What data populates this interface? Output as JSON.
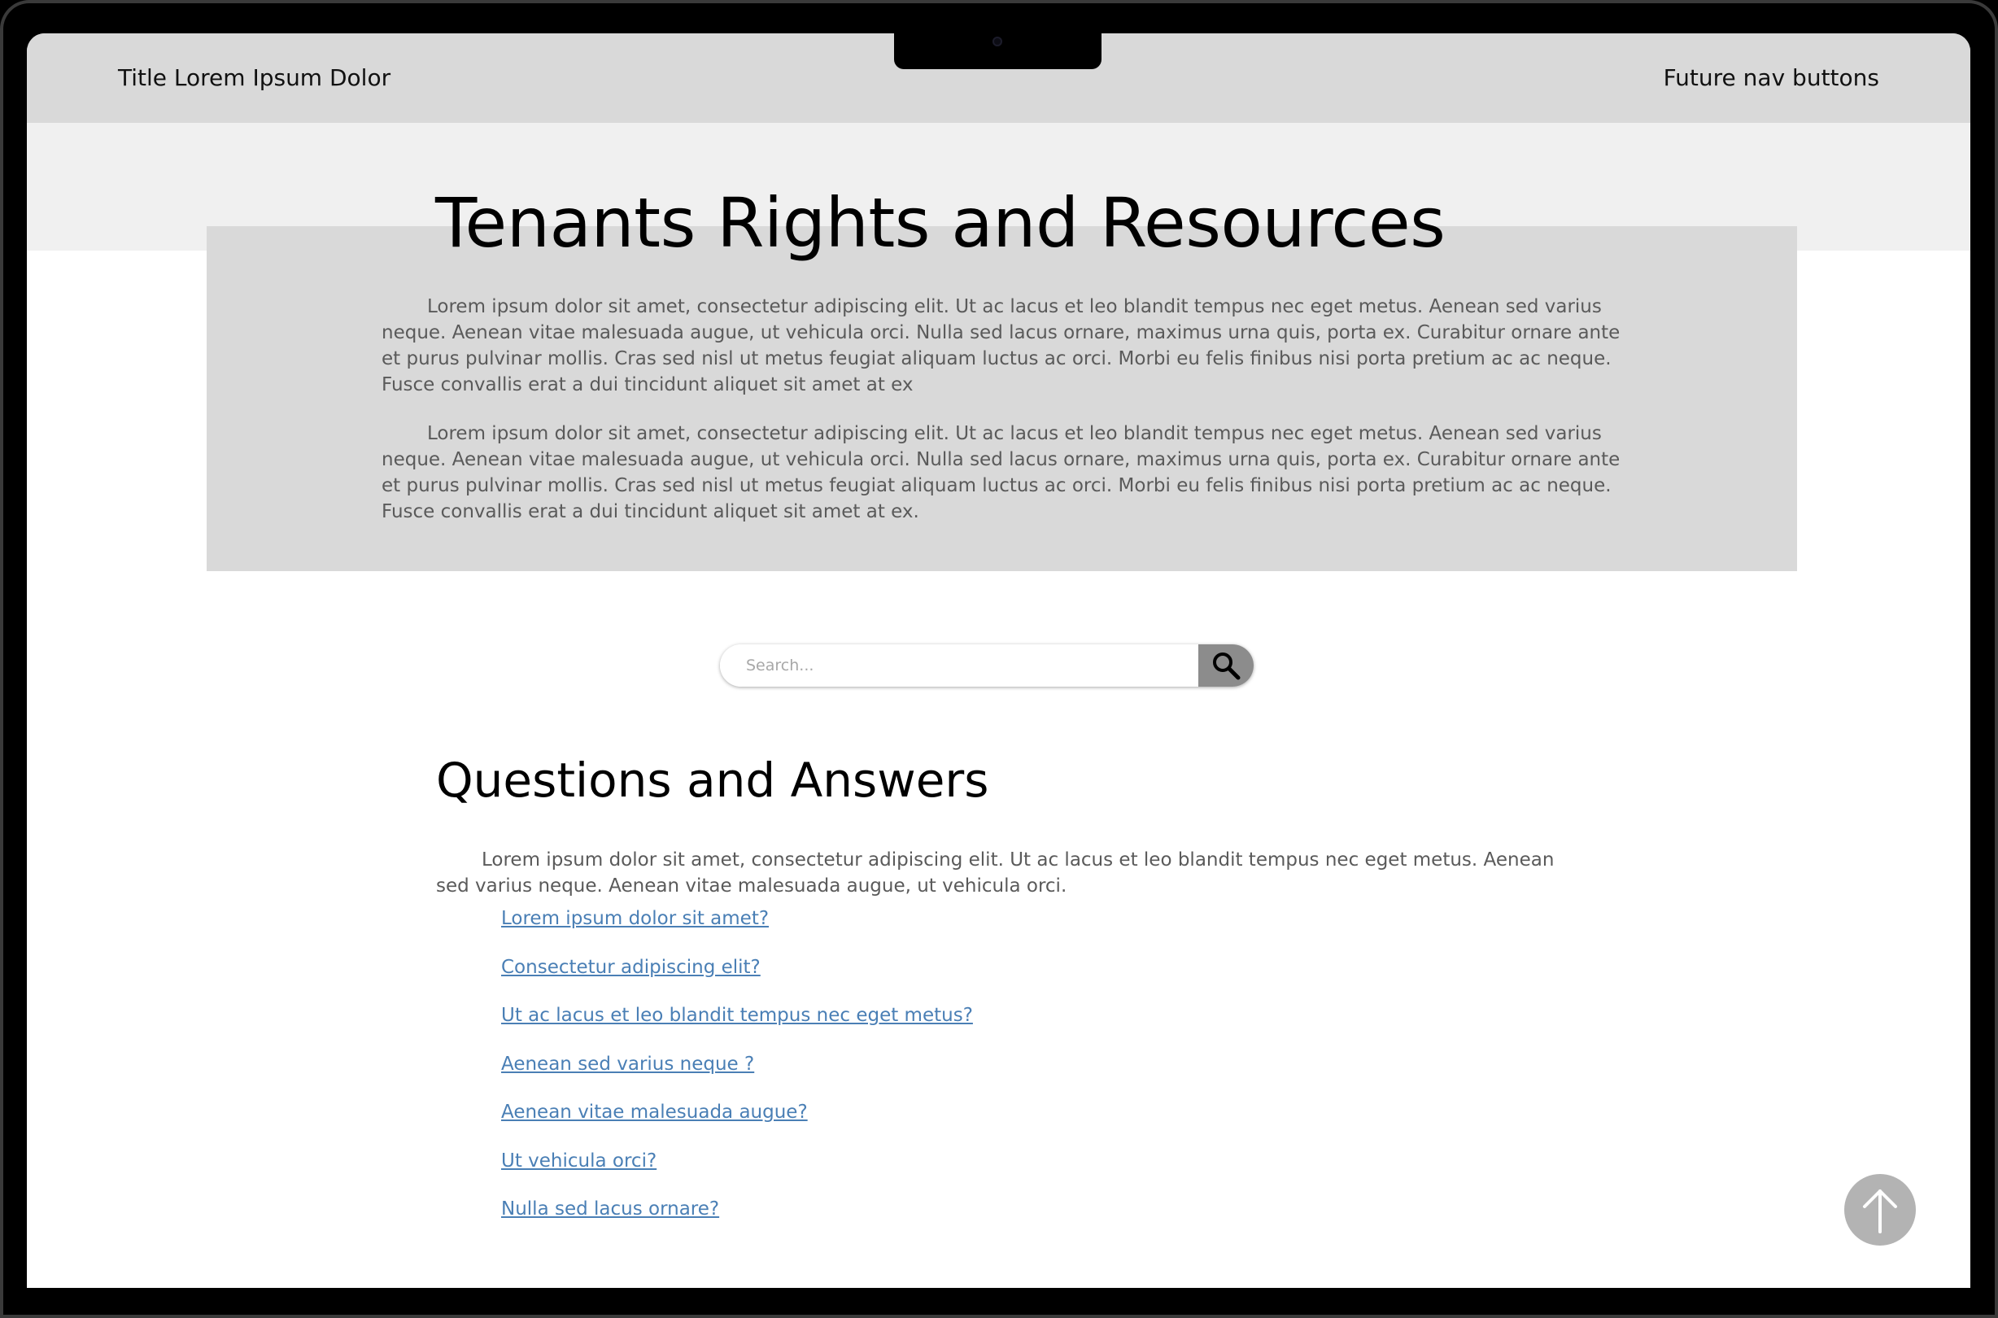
{
  "header": {
    "title": "Title Lorem Ipsum Dolor",
    "nav_text": "Future nav buttons"
  },
  "hero": {
    "title": "Tenants Rights and Resources",
    "paragraphs": [
      "Lorem ipsum dolor sit amet, consectetur adipiscing elit. Ut ac lacus et leo blandit tempus nec eget metus. Aenean sed varius neque. Aenean vitae malesuada augue, ut vehicula orci. Nulla sed lacus ornare, maximus urna quis, porta ex. Curabitur ornare ante et purus pulvinar mollis. Cras sed nisl ut metus feugiat aliquam luctus ac orci. Morbi eu felis finibus nisi porta pretium ac ac neque. Fusce convallis erat a dui tincidunt aliquet sit amet at ex",
      "Lorem ipsum dolor sit amet, consectetur adipiscing elit. Ut ac lacus et leo blandit tempus nec eget metus. Aenean sed varius neque. Aenean vitae malesuada augue, ut vehicula orci. Nulla sed lacus ornare, maximus urna quis, porta ex. Curabitur ornare ante et purus pulvinar mollis. Cras sed nisl ut metus feugiat aliquam luctus ac orci. Morbi eu felis finibus nisi porta pretium ac ac neque. Fusce convallis erat a dui tincidunt aliquet sit amet at ex."
    ]
  },
  "search": {
    "placeholder": "Search...",
    "icon": "search-icon"
  },
  "qa": {
    "title": "Questions and Answers",
    "intro": "Lorem ipsum dolor sit amet, consectetur adipiscing elit. Ut ac lacus et leo blandit tempus nec eget metus. Aenean sed varius neque. Aenean vitae malesuada augue, ut vehicula orci.",
    "links": [
      "Lorem ipsum dolor sit amet?",
      "Consectetur adipiscing elit?",
      "Ut ac lacus et leo blandit tempus nec eget metus?",
      "Aenean sed varius neque ?",
      "Aenean vitae malesuada augue?",
      "Ut vehicula orci?",
      "Nulla sed lacus ornare?"
    ]
  },
  "back_to_top": {
    "icon": "arrow-up-icon"
  },
  "colors": {
    "header_bg": "#d9d9d9",
    "band_bg": "#f0f0f0",
    "link": "#4a7fb5",
    "body_text": "#5a5a5a",
    "search_button": "#8c8c8c",
    "to_top_button": "#b3b3b3"
  }
}
